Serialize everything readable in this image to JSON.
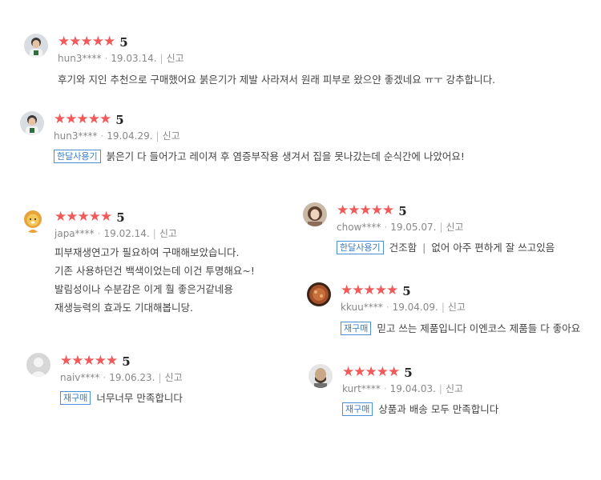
{
  "star_color": "#f05a5a",
  "tag_color": "#3a7cc8",
  "reviews": [
    {
      "rating": 5,
      "score": "5",
      "user": "hun3****",
      "date": "19.03.14.",
      "report": "신고",
      "avatar": "person-photo-avatar",
      "lines": [
        "후기와 지인 추천으로 구매했어요 붉은기가 제발 사라져서 원래 피부로 왔으얀 좋겠네요 ㅠㅜ 강추합니다."
      ]
    },
    {
      "rating": 5,
      "score": "5",
      "user": "hun3****",
      "date": "19.04.29.",
      "report": "신고",
      "avatar": "person-photo-avatar",
      "tag": "한달사용기",
      "lines": [
        "붉은기 다 들어가고 레이져 후 염증부작용 생겨서 집을 못나갔는데 순식간에 나았어요!"
      ]
    },
    {
      "rating": 5,
      "score": "5",
      "user": "japa****",
      "date": "19.02.14.",
      "report": "신고",
      "avatar": "lion-character-avatar",
      "lines": [
        "피부재생연고가 필요하여 구매해보았습니다.",
        "기존 사용하던건 백색이었는데 이건 투명해요~!",
        "발림성이나 수분감은 이게 훨 좋은거같네용",
        "재생능력의 효과도 기대해봅니당."
      ]
    },
    {
      "rating": 5,
      "score": "5",
      "user": "naiv****",
      "date": "19.06.23.",
      "report": "신고",
      "avatar": "default-user-avatar",
      "tag": "재구매",
      "lines": [
        "너무너무 만족합니다"
      ]
    },
    {
      "rating": 5,
      "score": "5",
      "user": "chow****",
      "date": "19.05.07.",
      "report": "신고",
      "avatar": "woman-photo-avatar",
      "tag": "한달사용기",
      "text_a": "건조함",
      "pipe": "|",
      "text_b": "없어 아주 편하게 잘 쓰고있음"
    },
    {
      "rating": 5,
      "score": "5",
      "user": "kkuu****",
      "date": "19.04.09.",
      "report": "신고",
      "avatar": "food-photo-avatar",
      "tag": "재구매",
      "lines": [
        "믿고 쓰는 제품입니다 이엔코스 제품들 다 좋아요"
      ]
    },
    {
      "rating": 5,
      "score": "5",
      "user": "kurt****",
      "date": "19.04.03.",
      "report": "신고",
      "avatar": "man-photo-avatar",
      "tag": "재구매",
      "lines": [
        "상품과 배송 모두 만족합니다"
      ]
    }
  ]
}
